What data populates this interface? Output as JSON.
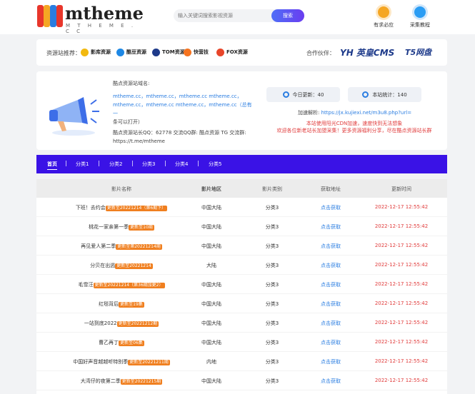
{
  "header": {
    "logo_text": "mtheme",
    "logo_sub": "M T H E M E . C C",
    "search_placeholder": "输入关键词搜索影视资源",
    "search_button": "搜索",
    "links": [
      {
        "label": "有求必应",
        "icon": "emoji-icon",
        "color": "#f5a623"
      },
      {
        "label": "采集教程",
        "icon": "location-pin-icon",
        "color": "#2a9df4"
      }
    ]
  },
  "resbar": {
    "title": "资源站推荐：",
    "items": [
      {
        "label": "影库资源",
        "icon": "yingku-logo-icon",
        "color": "#f2b90f"
      },
      {
        "label": "酷豆资源",
        "icon": "kudou-logo-icon",
        "color": "#1e88e5"
      },
      {
        "label": "TOM资源",
        "icon": "tom-logo-icon",
        "color": "#1e3a8a"
      },
      {
        "label": "快营技",
        "icon": "kuaiyingji-logo-icon",
        "color": "#f5731f"
      },
      {
        "label": "FOX资源",
        "icon": "fox-logo-icon",
        "color": "#e8462a"
      }
    ],
    "partner_title": "合作伙伴：",
    "partners": [
      "YH 英皇CMS",
      "T5网盘"
    ]
  },
  "info": {
    "domain_title": "酷点资源站域名:",
    "domains_line1": "mtheme.cc，mtheme.cc，mtheme.cc mtheme.cc，",
    "domains_line2": "mtheme.cc，mtheme.cc mtheme.cc，mtheme.cc（总有一",
    "domains_line3": "条可以打开）",
    "qq_line": "酷点资源站长QQ：62778 交流QQ群: 酷点资源 TG 交流群:",
    "tg_line": "https://t.me/mtheme",
    "today_update": "今日更新：40",
    "total": "本站统计：140",
    "speed_label": "加速解析:",
    "speed_url": "https://jx.kujiexi.net/m3u8.php?url=",
    "notice1": "本站使用阳光CDN加速，速度快到无法想象",
    "notice2": "欢迎各位新老站长加盟采集！更多资源福利分享，尽在酷点资源站长群"
  },
  "nav": [
    "首页",
    "分类1",
    "分类2",
    "分类3",
    "分类4",
    "分类5"
  ],
  "table": {
    "headers": [
      "影片名称",
      "影片地区",
      "影片类别",
      "获取地址",
      "更新时间"
    ],
    "rows": [
      {
        "name": "下班！去约会",
        "badge": "更新至20221214（第6期下）",
        "area": "中国大陆",
        "cat": "分类3",
        "get": "点击获取",
        "time": "2022-12-17 12:55:42"
      },
      {
        "name": "桃花一家亲第一季",
        "badge": "更新至10期",
        "area": "中国大陆",
        "cat": "分类3",
        "get": "点击获取",
        "time": "2022-12-17 12:55:42"
      },
      {
        "name": "再见爱人第二季",
        "badge": "更新至第20221214期",
        "area": "中国大陆",
        "cat": "分类3",
        "get": "点击获取",
        "time": "2022-12-17 12:55:42"
      },
      {
        "name": "分贝在出逃",
        "badge": "更新至20221214",
        "area": "大陆",
        "cat": "分类3",
        "get": "点击获取",
        "time": "2022-12-17 12:55:42"
      },
      {
        "name": "毛雪汪",
        "badge": "更新至20221214（第36期加更2）",
        "area": "中国大陆",
        "cat": "分类3",
        "get": "点击获取",
        "time": "2022-12-17 12:55:42"
      },
      {
        "name": "红毯背后",
        "badge": "更新至19集",
        "area": "中国大陆",
        "cat": "分类3",
        "get": "点击获取",
        "time": "2022-12-17 12:55:42"
      },
      {
        "name": "一站到底2022",
        "badge": "更新至20221212期",
        "area": "中国大陆",
        "cat": "分类3",
        "get": "点击获取",
        "time": "2022-12-17 12:55:42"
      },
      {
        "name": "曹乙再丁",
        "badge": "更新至06集",
        "area": "中国大陆",
        "cat": "分类3",
        "get": "点击获取",
        "time": "2022-12-17 12:55:42"
      },
      {
        "name": "中国好声音越越听特别季",
        "badge": "更新至20221211期",
        "area": "内地",
        "cat": "分类3",
        "get": "点击获取",
        "time": "2022-12-17 12:55:42"
      },
      {
        "name": "大湾仔的夜第二季",
        "badge": "更新至20221215期",
        "area": "中国大陆",
        "cat": "分类3",
        "get": "点击获取",
        "time": "2022-12-17 12:55:42"
      }
    ]
  }
}
